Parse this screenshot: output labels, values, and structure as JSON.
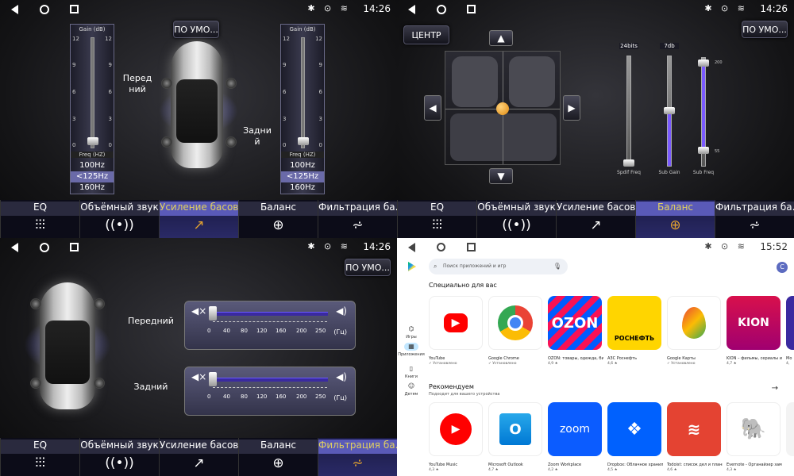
{
  "status": {
    "time_dark": "14:26",
    "time_light": "15:52"
  },
  "q1": {
    "preset_button": "ПО УМО...",
    "slider_header": "Gain  (dB)",
    "ticks": [
      "12",
      "9",
      "6",
      "3",
      "0"
    ],
    "freq_label": "Freq  (HZ)",
    "left_options": [
      "100Hz",
      "<125Hz",
      "160Hz"
    ],
    "right_options": [
      "100Hz",
      "<125Hz",
      "160Hz"
    ],
    "front_label": "Перед ний",
    "rear_label": "Задни й"
  },
  "tabs": {
    "eq": "EQ",
    "surround": "Объёмный звук",
    "bass": "Усиление басов",
    "balance": "Баланс",
    "filter": "Фильтрация ба..."
  },
  "q2": {
    "center_button": "ЦЕНТР",
    "preset_button": "ПО УМО...",
    "slider_tops": [
      "24bits",
      "7db"
    ],
    "bottom_labels": [
      "Spdif Freq",
      "Sub Gain",
      "Sub Freq"
    ],
    "sub_freq_top_tick": "200",
    "sub_freq_bottom_tick": "55"
  },
  "q3": {
    "preset_button": "ПО УМО...",
    "front_label": "Передний",
    "rear_label": "Задний",
    "nums": [
      "0",
      "40",
      "80",
      "120",
      "160",
      "200",
      "250"
    ],
    "unit": "(Гц)"
  },
  "q4": {
    "search_placeholder": "Поиск приложений и игр",
    "avatar": "С",
    "side": [
      "Игры",
      "Приложения",
      "Книги",
      "Детям"
    ],
    "sec1": "Специально для вас",
    "sec2": "Рекомендуем",
    "sec2_sub": "Подходит для вашего устройства",
    "apps1": [
      {
        "name": "YouTube",
        "meta": "✓ Установлено",
        "tile": "▶"
      },
      {
        "name": "Google Chrome",
        "meta": "✓ Установлено",
        "tile": ""
      },
      {
        "name": "OZON: товары, одежда, билеты",
        "meta": "4,9 ★",
        "tile": "OZON"
      },
      {
        "name": "АЗС Роснефть",
        "meta": "4,6 ★",
        "tile": "РОСНЕФТЬ"
      },
      {
        "name": "Google Карты",
        "meta": "✓ Установлено",
        "tile": ""
      },
      {
        "name": "KION – фильмы, сериалы и тв",
        "meta": "4,7 ★",
        "tile": "KION"
      },
      {
        "name": "Mo",
        "meta": "4,",
        "tile": ""
      }
    ],
    "apps2": [
      {
        "name": "YouTube Music",
        "meta": "4,3 ★",
        "tile": "▶"
      },
      {
        "name": "Microsoft Outlook",
        "meta": "4,7 ★",
        "tile": "O"
      },
      {
        "name": "Zoom Workplace",
        "meta": "4,2 ★",
        "tile": "zoom"
      },
      {
        "name": "Dropbox: Облачное хранилище",
        "meta": "4,5 ★",
        "tile": ""
      },
      {
        "name": "Todoist: список дел и планы",
        "meta": "4,6 ★",
        "tile": ""
      },
      {
        "name": "Evernote - Органайзер заметок",
        "meta": "4,3 ★",
        "tile": ""
      },
      {
        "name": "",
        "meta": "",
        "tile": ""
      }
    ]
  },
  "colors": {
    "accent": "#5a5ab8",
    "active_icon": "#e0a030",
    "slider_fill": "#7a5aff"
  }
}
